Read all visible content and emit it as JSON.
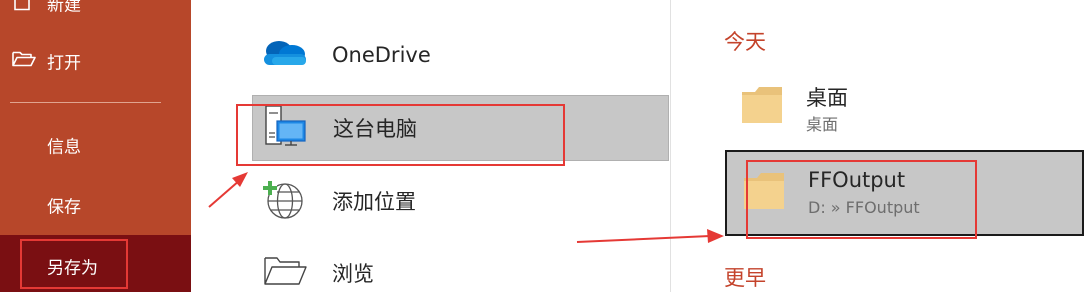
{
  "sidebar": {
    "items": [
      {
        "label": "新建",
        "icon": "new-document-icon"
      },
      {
        "label": "打开",
        "icon": "open-folder-icon"
      },
      {
        "label": "信息"
      },
      {
        "label": "保存"
      },
      {
        "label": "另存为"
      }
    ],
    "active_index": 4
  },
  "locations": [
    {
      "label": "OneDrive",
      "icon": "onedrive-cloud-icon"
    },
    {
      "label": "这台电脑",
      "icon": "this-pc-icon"
    },
    {
      "label": "添加位置",
      "icon": "add-place-globe-icon"
    },
    {
      "label": "浏览",
      "icon": "browse-folder-icon"
    }
  ],
  "recent": {
    "today_heading": "今天",
    "earlier_heading": "更早",
    "folders": [
      {
        "name": "桌面",
        "path": "桌面",
        "icon": "folder-icon"
      },
      {
        "name": "FFOutput",
        "path": "D: » FFOutput",
        "icon": "folder-icon"
      }
    ]
  },
  "colors": {
    "sidebar_bg": "#b7472a",
    "sidebar_active": "#7a0f12",
    "section_heading": "#c4432b",
    "annotation_red": "#e53935",
    "selected_bg": "#c7c7c7"
  }
}
